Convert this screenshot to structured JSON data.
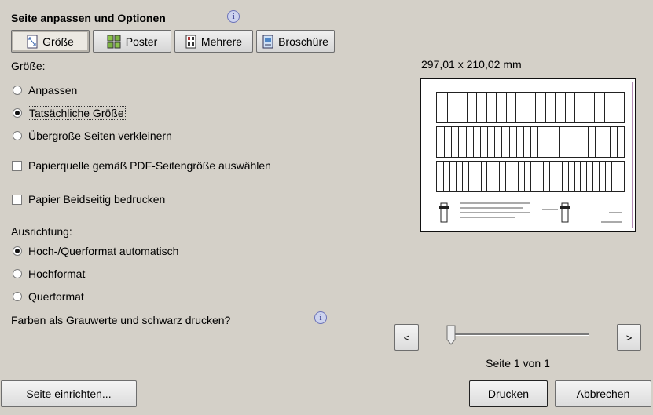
{
  "header": {
    "title": "Seite anpassen und Optionen"
  },
  "tabs": [
    {
      "label": "Größe",
      "icon": "size-icon",
      "active": true
    },
    {
      "label": "Poster",
      "icon": "poster-icon",
      "active": false
    },
    {
      "label": "Mehrere",
      "icon": "multiple-icon",
      "active": false
    },
    {
      "label": "Broschüre",
      "icon": "brochure-icon",
      "active": false
    }
  ],
  "size": {
    "label": "Größe:",
    "options": [
      {
        "label": "Anpassen",
        "checked": false
      },
      {
        "label": "Tatsächliche Größe",
        "checked": true
      },
      {
        "label": "Übergroße Seiten verkleinern",
        "checked": false
      }
    ]
  },
  "checkboxes": [
    {
      "label": "Papierquelle gemäß PDF-Seitengröße auswählen",
      "checked": false
    },
    {
      "label": "Papier Beidseitig bedrucken",
      "checked": false
    }
  ],
  "orientation": {
    "label": "Ausrichtung:",
    "options": [
      {
        "label": "Hoch-/Querformat automatisch",
        "checked": true
      },
      {
        "label": "Hochformat",
        "checked": false
      },
      {
        "label": "Querformat",
        "checked": false
      }
    ]
  },
  "grayscale": {
    "label": "Farben als Grauwerte und schwarz drucken?"
  },
  "preview": {
    "dimensions": "297,01 x 210,02 mm",
    "page_status": "Seite 1 von 1",
    "prev_label": "<",
    "next_label": ">",
    "slider_value": 0
  },
  "footer": {
    "setup_label": "Seite einrichten...",
    "print_label": "Drucken",
    "cancel_label": "Abbrechen"
  },
  "colors": {
    "background": "#d4d0c8",
    "info_accent": "#6b72b8"
  }
}
